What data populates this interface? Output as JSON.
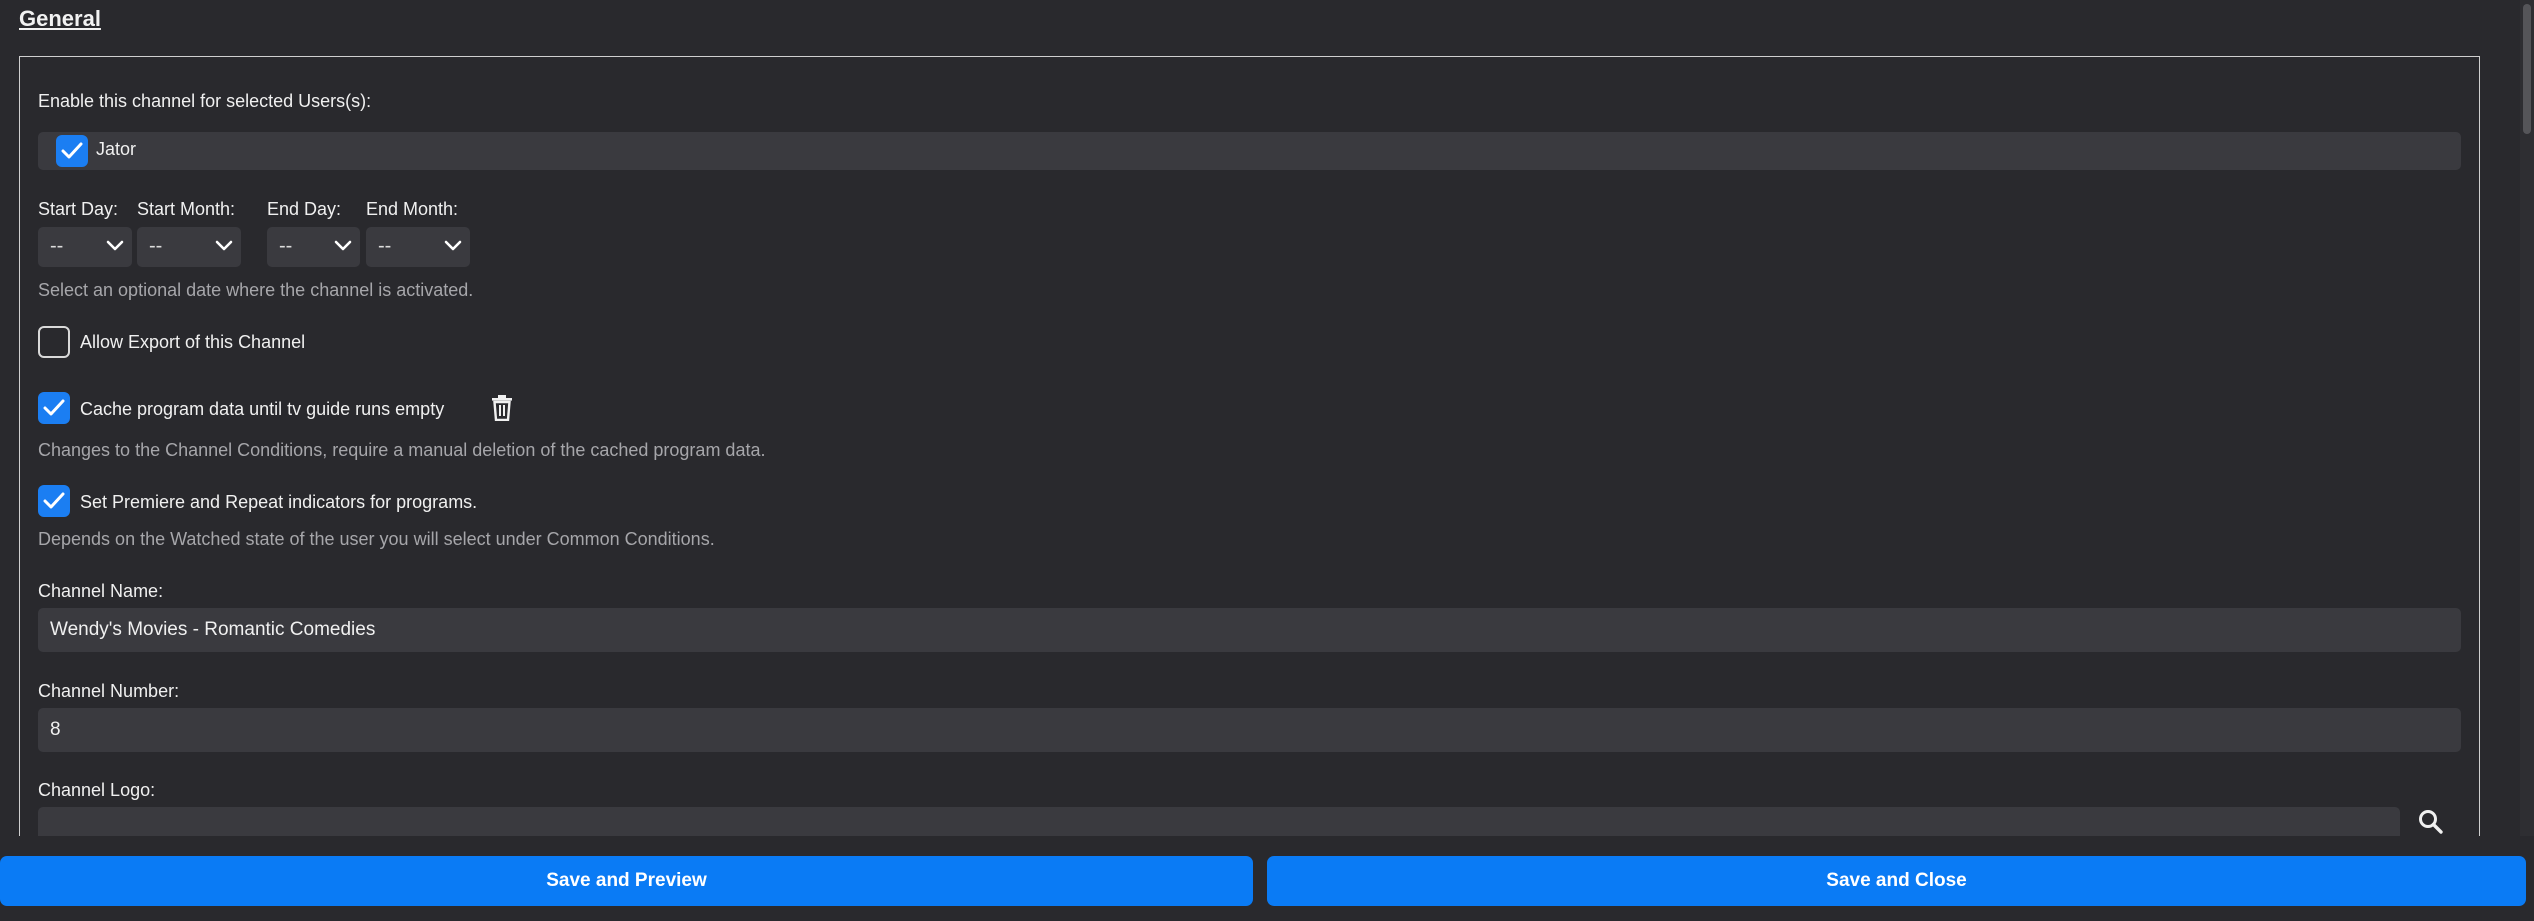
{
  "section": {
    "title": "General"
  },
  "users": {
    "label": "Enable this channel for selected Users(s):",
    "items": [
      {
        "name": "Jator",
        "checked": true
      }
    ]
  },
  "dates": {
    "start_day_label": "Start Day:",
    "start_month_label": "Start Month:",
    "end_day_label": "End Day:",
    "end_month_label": "End Month:",
    "start_day_value": "--",
    "start_month_value": "--",
    "end_day_value": "--",
    "end_month_value": "--",
    "hint": "Select an optional date where the channel is activated."
  },
  "options": {
    "allow_export": {
      "label": "Allow Export of this Channel",
      "checked": false
    },
    "cache_program": {
      "label": "Cache program data until tv guide runs empty",
      "checked": true
    },
    "cache_hint": "Changes to the Channel Conditions, require a manual deletion of the cached program data.",
    "premiere": {
      "label": "Set Premiere and Repeat indicators for programs.",
      "checked": true
    },
    "premiere_hint": "Depends on the Watched state of the user you will select under Common Conditions."
  },
  "channel": {
    "name_label": "Channel Name:",
    "name_value": "Wendy's Movies - Romantic Comedies",
    "number_label": "Channel Number:",
    "number_value": "8",
    "logo_label": "Channel Logo:",
    "logo_value": ""
  },
  "footer": {
    "save_preview": "Save and Preview",
    "save_close": "Save and Close"
  },
  "colors": {
    "background": "#29292d",
    "field": "#3a3a3f",
    "accent": "#0a7bf5",
    "checkbox": "#1b7ef2"
  },
  "icons": {
    "checkbox": "check-icon",
    "dropdown": "chevron-down-icon",
    "delete": "trash-icon",
    "search": "search-icon"
  }
}
